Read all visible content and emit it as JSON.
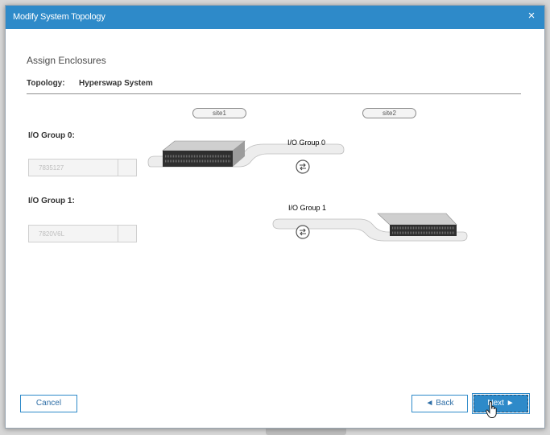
{
  "dialog": {
    "title": "Modify System Topology",
    "close_glyph": "×"
  },
  "section_title": "Assign Enclosures",
  "topology": {
    "label": "Topology:",
    "value": "Hyperswap System"
  },
  "sites": [
    "site1",
    "site2"
  ],
  "io_groups": [
    {
      "label": "I/O Group 0:",
      "selected": "7835127",
      "diagram_label": "I/O Group 0"
    },
    {
      "label": "I/O Group 1:",
      "selected": "7820V6L",
      "diagram_label": "I/O Group 1"
    }
  ],
  "icons": {
    "swap": "swap-icon",
    "enclosure": "storage-enclosure-icon",
    "cursor": "hand-pointer-icon"
  },
  "buttons": {
    "cancel": "Cancel",
    "back": "◄ Back",
    "next": "Next ►"
  },
  "colors": {
    "titlebar": "#2e8ac9",
    "accent": "#2e8ac9"
  }
}
